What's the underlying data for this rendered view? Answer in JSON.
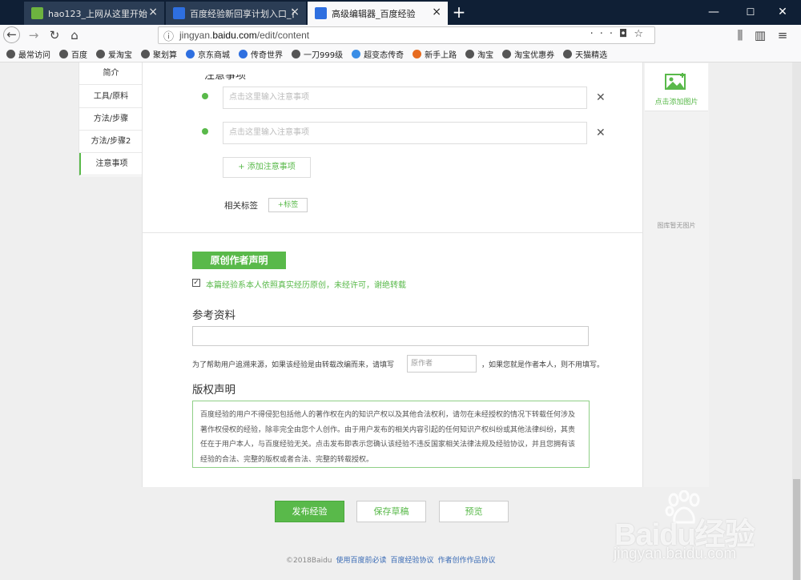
{
  "browser": {
    "tabs": [
      {
        "title": "hao123_上网从这里开始",
        "favicon_color": "#6db33f"
      },
      {
        "title": "百度经验新回享计划入口_百度",
        "favicon_color": "#2e6fe0"
      },
      {
        "title": "高级编辑器_百度经验",
        "favicon_color": "#2e6fe0"
      }
    ],
    "url": {
      "prefix": "jingyan.",
      "host": "baidu.com",
      "path": "/edit/content"
    },
    "bookmarks": [
      "最常访问",
      "百度",
      "爱淘宝",
      "聚划算",
      "京东商城",
      "传奇世界",
      "一刀999级",
      "超变态传奇",
      "新手上路",
      "淘宝",
      "淘宝优惠券",
      "天猫精选"
    ]
  },
  "sidebar": {
    "items": [
      "简介",
      "工具/原料",
      "方法/步骤",
      "方法/步骤2",
      "注意事项"
    ]
  },
  "notes": {
    "title": "注意事项",
    "placeholder": "点击这里输入注意事项",
    "add_label": "+ 添加注意事项",
    "tag_label": "相关标签",
    "tag_button": "+标签"
  },
  "original": {
    "button": "原创作者声明",
    "checkbox_checked": true,
    "statement": "本篇经验系本人依照真实经历原创，未经许可，谢绝转载"
  },
  "reference": {
    "title": "参考资料",
    "source_text_before": "为了帮助用户追溯来源，如果该经验是由转载改编而来，请填写",
    "author_placeholder": "原作者",
    "source_text_after": "，如果您就是作者本人，则不用填写。"
  },
  "copyright": {
    "title": "版权声明",
    "text": "百度经验的用户不得侵犯包括他人的著作权在内的知识产权以及其他合法权利，请勿在未经授权的情况下转载任何涉及著作权侵权的经验，除非完全由您个人创作。由于用户发布的相关内容引起的任何知识产权纠纷或其他法律纠纷，其责任在于用户本人，与百度经验无关。点击发布即表示您确认该经验不违反国家相关法律法规及经验协议，并且您拥有该经验的合法、完整的版权或者合法、完整的转载授权。"
  },
  "right_panel": {
    "add_image": "点击添加图片",
    "empty": "图库暂无图片"
  },
  "actions": {
    "publish": "发布经验",
    "save_draft": "保存草稿",
    "preview": "预览"
  },
  "footer": {
    "copyright": "©2018Baidu",
    "links": [
      "使用百度前必读",
      "百度经验协议",
      "作者创作作品协议"
    ]
  },
  "watermark": {
    "brand": "Baidu经验",
    "url": "jingyan.baidu.com"
  },
  "colors": {
    "accent": "#59b94a",
    "tabbar": "#0f1f35",
    "link": "#3a6bb5"
  }
}
